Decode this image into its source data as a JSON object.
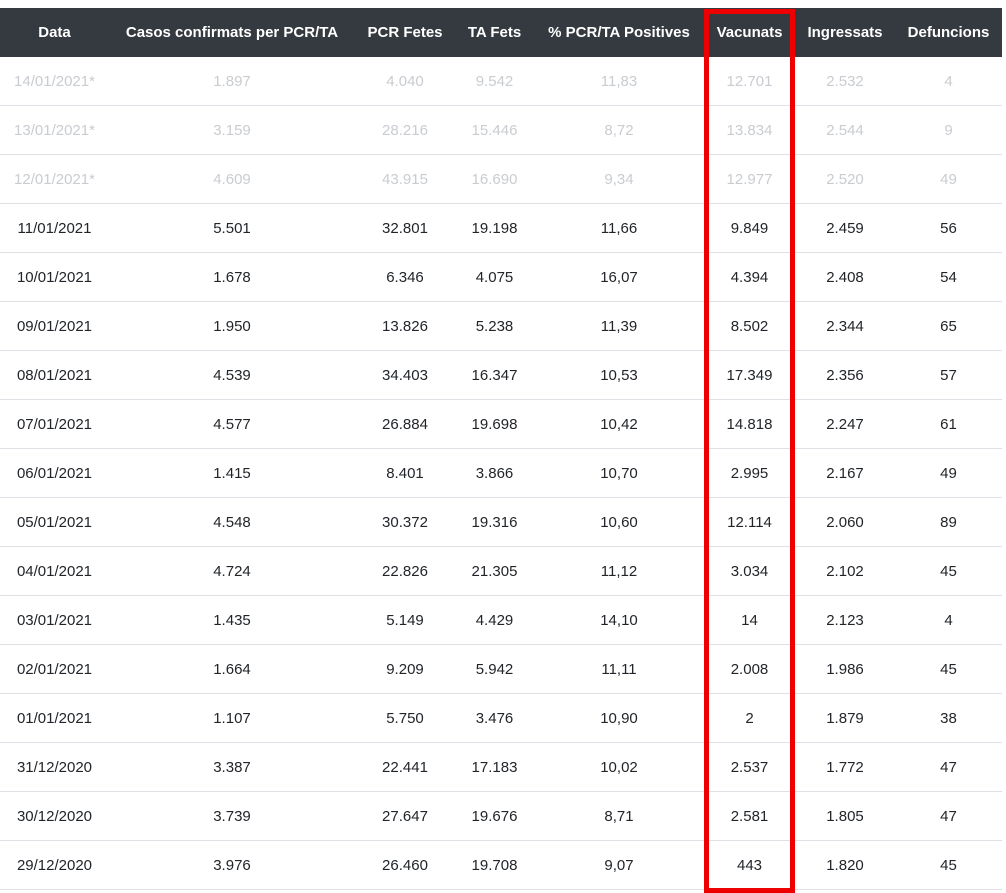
{
  "table": {
    "headers": [
      "Data",
      "Casos confirmats per PCR/TA",
      "PCR Fetes",
      "TA Fets",
      "% PCR/TA Positives",
      "Vacunats",
      "Ingressats",
      "Defuncions"
    ],
    "rows": [
      [
        "14/01/2021*",
        "1.897",
        "4.040",
        "9.542",
        "11,83",
        "12.701",
        "2.532",
        "4"
      ],
      [
        "13/01/2021*",
        "3.159",
        "28.216",
        "15.446",
        "8,72",
        "13.834",
        "2.544",
        "9"
      ],
      [
        "12/01/2021*",
        "4.609",
        "43.915",
        "16.690",
        "9,34",
        "12.977",
        "2.520",
        "49"
      ],
      [
        "11/01/2021",
        "5.501",
        "32.801",
        "19.198",
        "11,66",
        "9.849",
        "2.459",
        "56"
      ],
      [
        "10/01/2021",
        "1.678",
        "6.346",
        "4.075",
        "16,07",
        "4.394",
        "2.408",
        "54"
      ],
      [
        "09/01/2021",
        "1.950",
        "13.826",
        "5.238",
        "11,39",
        "8.502",
        "2.344",
        "65"
      ],
      [
        "08/01/2021",
        "4.539",
        "34.403",
        "16.347",
        "10,53",
        "17.349",
        "2.356",
        "57"
      ],
      [
        "07/01/2021",
        "4.577",
        "26.884",
        "19.698",
        "10,42",
        "14.818",
        "2.247",
        "61"
      ],
      [
        "06/01/2021",
        "1.415",
        "8.401",
        "3.866",
        "10,70",
        "2.995",
        "2.167",
        "49"
      ],
      [
        "05/01/2021",
        "4.548",
        "30.372",
        "19.316",
        "10,60",
        "12.114",
        "2.060",
        "89"
      ],
      [
        "04/01/2021",
        "4.724",
        "22.826",
        "21.305",
        "11,12",
        "3.034",
        "2.102",
        "45"
      ],
      [
        "03/01/2021",
        "1.435",
        "5.149",
        "4.429",
        "14,10",
        "14",
        "2.123",
        "4"
      ],
      [
        "02/01/2021",
        "1.664",
        "9.209",
        "5.942",
        "11,11",
        "2.008",
        "1.986",
        "45"
      ],
      [
        "01/01/2021",
        "1.107",
        "5.750",
        "3.476",
        "10,90",
        "2",
        "1.879",
        "38"
      ],
      [
        "31/12/2020",
        "3.387",
        "22.441",
        "17.183",
        "10,02",
        "2.537",
        "1.772",
        "47"
      ],
      [
        "30/12/2020",
        "3.739",
        "27.647",
        "19.676",
        "8,71",
        "2.581",
        "1.805",
        "47"
      ],
      [
        "29/12/2020",
        "3.976",
        "26.460",
        "19.708",
        "9,07",
        "443",
        "1.820",
        "45"
      ]
    ]
  },
  "colors": {
    "header_background": "#343a40",
    "header_text": "#ffffff",
    "provisional_text": "#c9ccd0",
    "highlight_border": "#ee0000"
  }
}
